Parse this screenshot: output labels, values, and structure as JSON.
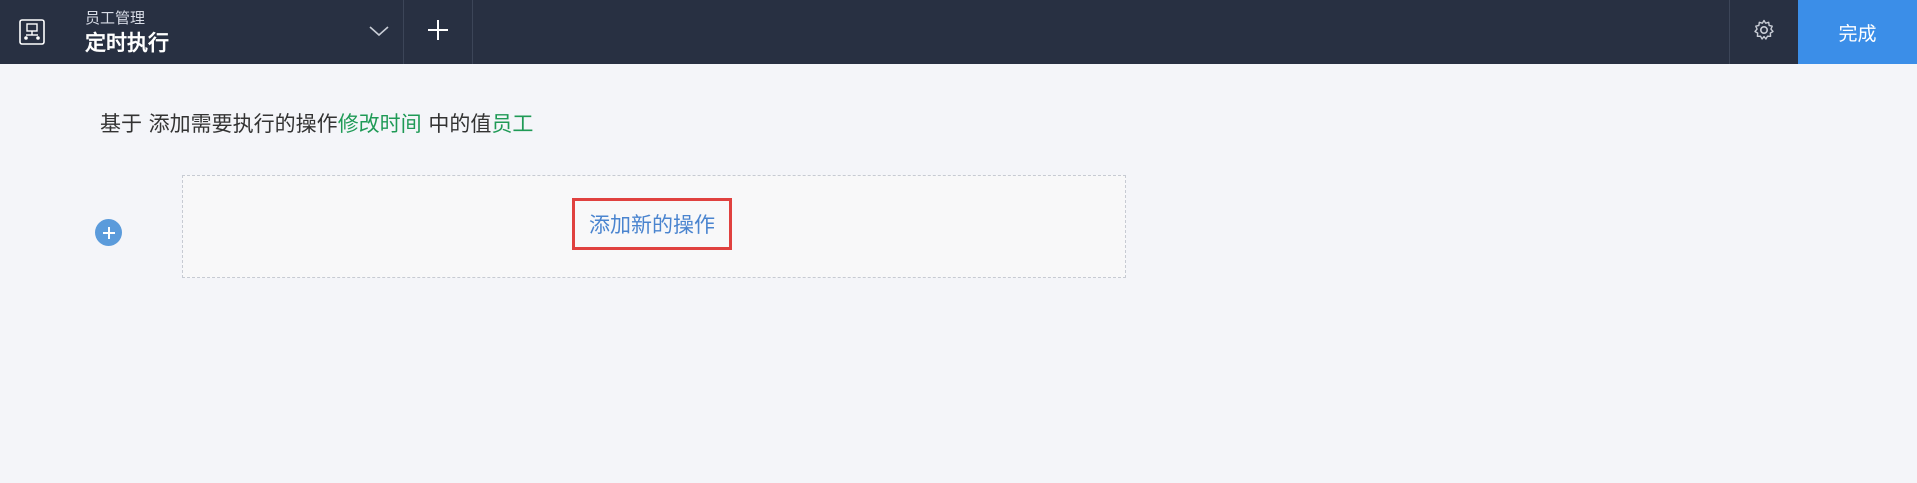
{
  "header": {
    "breadcrumb": "员工管理",
    "title": "定时执行",
    "app_icon": "workflow-icon",
    "dropdown_icon": "chevron-down-icon",
    "add_icon": "plus-icon",
    "settings_icon": "gear-icon",
    "done_label": "完成"
  },
  "main": {
    "description": {
      "prefix": "基于 添加需要执行的操作",
      "field": "修改时间",
      "middle": " 中的值",
      "target": "员工"
    },
    "add_operation_label": "添加新的操作",
    "add_circle_icon": "plus-circle-icon"
  },
  "colors": {
    "topbar": "#283042",
    "accent": "#3b8ee8",
    "highlight": "#1f9a56",
    "link": "#4a84cf",
    "marker": "#e0413f"
  }
}
